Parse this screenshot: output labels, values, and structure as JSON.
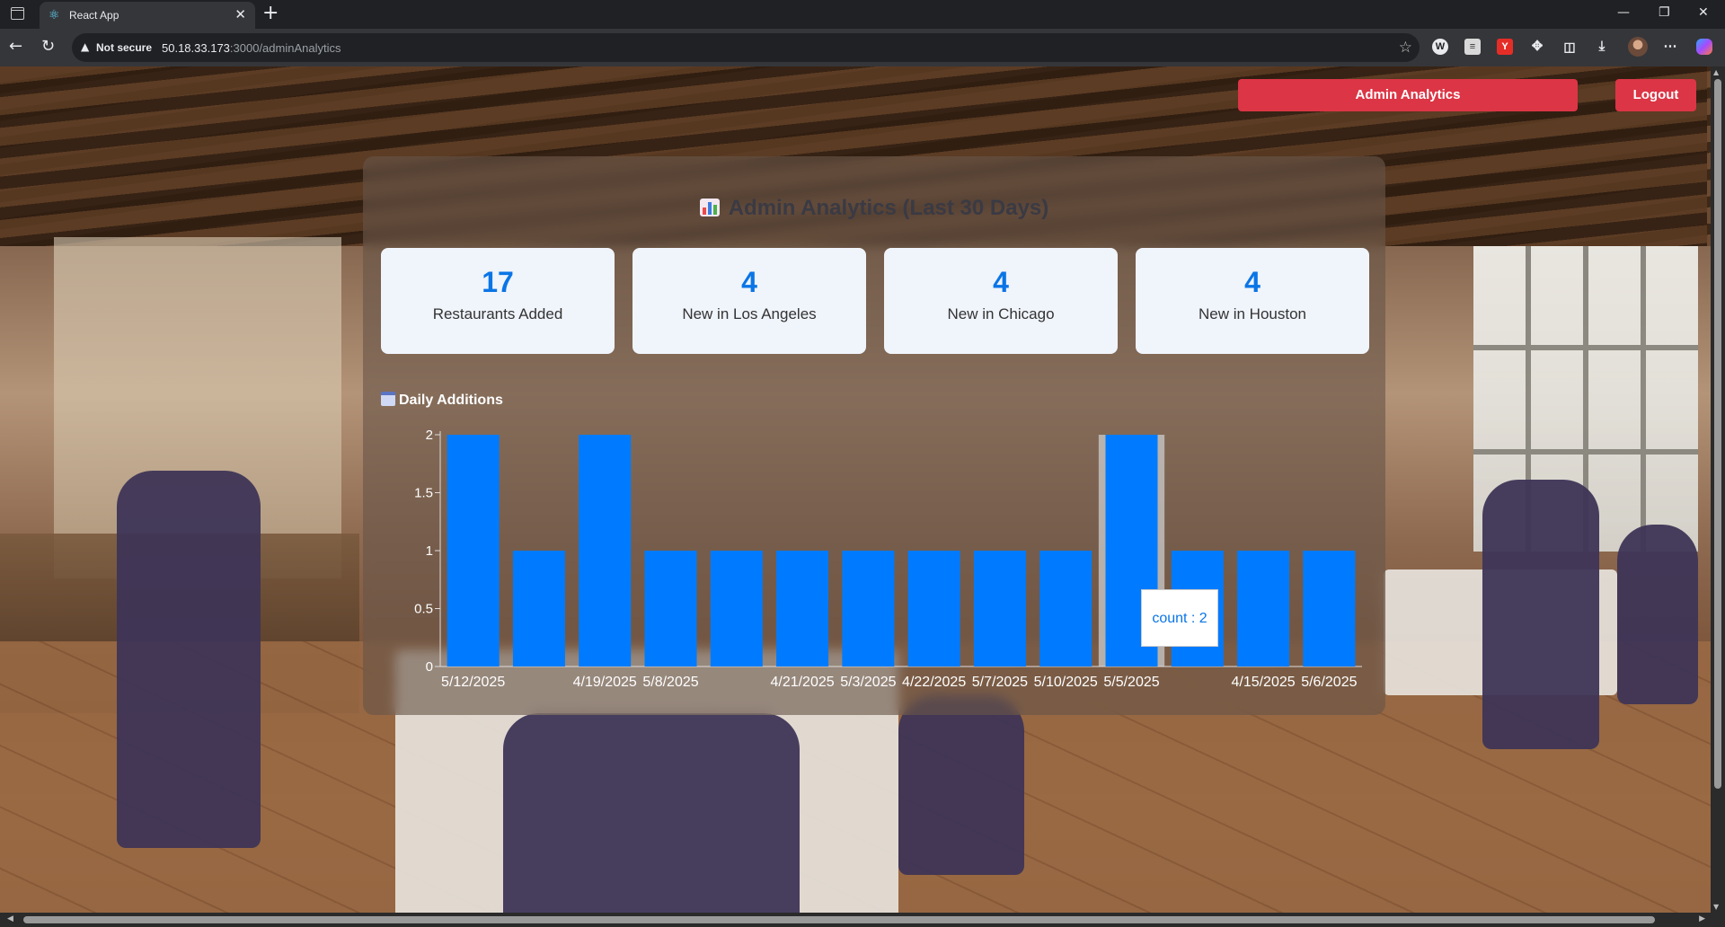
{
  "browser": {
    "tab_title": "React App",
    "security_label": "Not secure",
    "url_host": "50.18.33.173",
    "url_path": ":3000/adminAnalytics"
  },
  "header": {
    "admin_analytics_label": "Admin Analytics",
    "logout_label": "Logout"
  },
  "panel": {
    "title": "Admin Analytics (Last 30 Days)"
  },
  "stats": [
    {
      "value": "17",
      "label": "Restaurants Added"
    },
    {
      "value": "4",
      "label": "New in Los Angeles"
    },
    {
      "value": "4",
      "label": "New in Chicago"
    },
    {
      "value": "4",
      "label": "New in Houston"
    }
  ],
  "chart_title": "Daily Additions",
  "tooltip": {
    "text": "count : 2"
  },
  "colors": {
    "accent": "#007bff",
    "button_red": "#dc3545",
    "stat_number": "#0a75e6"
  },
  "chart_data": {
    "type": "bar",
    "categories": [
      "5/12/2025",
      "",
      "4/19/2025",
      "5/8/2025",
      "",
      "4/21/2025",
      "5/3/2025",
      "4/22/2025",
      "5/7/2025",
      "5/10/2025",
      "5/5/2025",
      "",
      "4/15/2025",
      "5/6/2025"
    ],
    "values": [
      2,
      1,
      2,
      1,
      1,
      1,
      1,
      1,
      1,
      1,
      2,
      1,
      1,
      1
    ],
    "yticks": [
      "0",
      "0.5",
      "1",
      "1.5",
      "2"
    ],
    "ylim": [
      0,
      2
    ],
    "highlighted_index": 10,
    "grid": false,
    "bar_color": "#007bff"
  }
}
